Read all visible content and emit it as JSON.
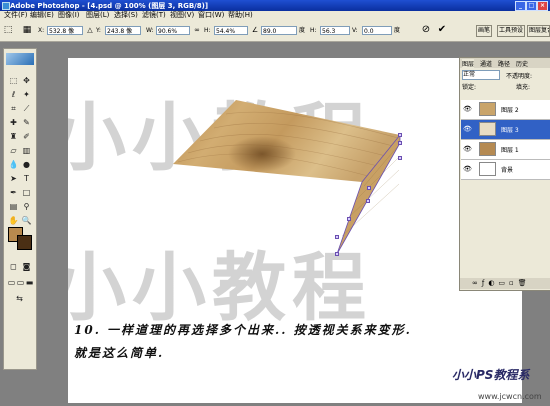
{
  "window": {
    "title": "Adobe Photoshop - [4.psd @ 100% (图层 3, RGB/8)]",
    "min": "_",
    "max": "□",
    "close": "×"
  },
  "menu": [
    "文件(F)",
    "编辑(E)",
    "图像(I)",
    "图层(L)",
    "选择(S)",
    "滤镜(T)",
    "视图(V)",
    "窗口(W)",
    "帮助(H)"
  ],
  "options": {
    "x_label": "X:",
    "x_value": "532.8 像",
    "y_label": "Y:",
    "y_value": "243.8 像",
    "w_label": "W:",
    "w_value": "90.6%",
    "h_label": "H:",
    "h_value": "54.4%",
    "rot_value": "89.0",
    "rot_unit": "度",
    "hskew_label": "H:",
    "hskew_value": "56.3",
    "vskew_label": "V:",
    "vskew_value": "0.0",
    "vskew_unit": "度",
    "cancel_icon": "cancel-icon",
    "commit_icon": "check-icon",
    "tab_brushes": "画笔",
    "tab_presets": "工具预设",
    "tab_comps": "图层复合"
  },
  "canvas": {
    "watermark_top": "小小教程",
    "watermark_bottom": "小小教程",
    "caption_line1": "10. 一样道理的再选择多个出来.. 按透视关系来变形.",
    "caption_line2": "就是这么简单.",
    "logo": "小小PS教程系",
    "url": "www.jcwcn.com"
  },
  "layers_panel": {
    "tabs": [
      "图层",
      "通道",
      "路径",
      "历史"
    ],
    "blend_mode": "正常",
    "opacity_label": "不透明度:",
    "lock_label": "锁定:",
    "fill_label": "填充:",
    "layers": [
      {
        "name": "图层 2",
        "selected": false,
        "thumb": "#c9a46a"
      },
      {
        "name": "图层 3",
        "selected": true,
        "thumb": "#e8dcc4"
      },
      {
        "name": "图层 1",
        "selected": false,
        "thumb": "#b58a52"
      },
      {
        "name": "背景",
        "selected": false,
        "thumb": "#ffffff"
      }
    ]
  },
  "colors": {
    "foreground": "#b88a4e",
    "background": "#4a2f14",
    "wood": "#c9a46a"
  }
}
